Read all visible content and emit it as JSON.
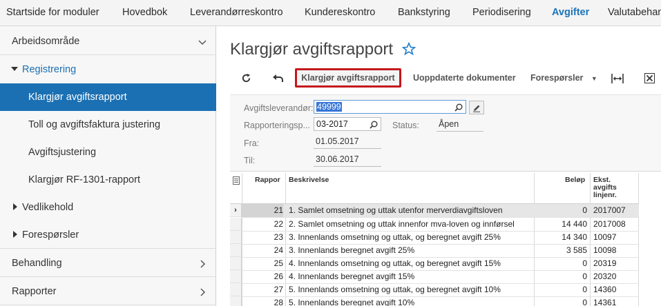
{
  "topnav": {
    "items": [
      "Startside for moduler",
      "Hovedbok",
      "Leverandørreskontro",
      "Kundereskontro",
      "Bankstyring",
      "Periodisering",
      "Avgifter",
      "Valutabehan"
    ],
    "active": "Avgifter"
  },
  "sidebar": {
    "items": [
      {
        "label": "Arbeidsområde",
        "icon": "chevron-down-icon"
      },
      {
        "label": "Registrering",
        "icon": "caret-down-icon"
      },
      {
        "label": "Klargjør avgiftsrapport"
      },
      {
        "label": "Toll og avgiftsfaktura justering"
      },
      {
        "label": "Avgiftsjustering"
      },
      {
        "label": "Klargjør RF-1301-rapport"
      },
      {
        "label": "Vedlikehold",
        "icon": "caret-right-icon"
      },
      {
        "label": "Forespørsler",
        "icon": "caret-right-icon"
      },
      {
        "label": "Behandling",
        "icon": "chevron-right-icon"
      },
      {
        "label": "Rapporter",
        "icon": "chevron-right-icon"
      }
    ]
  },
  "page": {
    "title": "Klargjør avgiftsrapport",
    "favorite_icon": "star-outline-icon"
  },
  "toolbar": {
    "refresh_icon": "refresh-icon",
    "undo_icon": "undo-icon",
    "prepare_label": "Klargjør avgiftsrapport",
    "unupdated_label": "Uoppdaterte dokumenter",
    "inquiries_label": "Forespørsler",
    "fit_icon": "fit-width-icon",
    "excel_icon": "excel-export-icon"
  },
  "form": {
    "vendor_label": "Avgiftsleverandør:",
    "vendor_value": "49999",
    "period_label": "Rapporteringsp...",
    "period_value": "03-2017",
    "status_label": "Status:",
    "status_value": "Åpen",
    "from_label": "Fra:",
    "from_value": "01.05.2017",
    "to_label": "Til:",
    "to_value": "30.06.2017"
  },
  "grid": {
    "headers": {
      "report": "Rappor",
      "description": "Beskrivelse",
      "amount": "Beløp",
      "ext1": "Ekst.",
      "ext2": "avgifts",
      "ext3": "linjenr."
    },
    "rows": [
      {
        "nr": "21",
        "desc": "1. Samlet omsetning og uttak utenfor merverdiavgiftsloven",
        "amount": "0",
        "ext": "2017007"
      },
      {
        "nr": "22",
        "desc": "2. Samlet omsetning og uttak innenfor mva-loven og innførsel",
        "amount": "14 440",
        "ext": "2017008"
      },
      {
        "nr": "23",
        "desc": "3. Innenlands omsetning og uttak, og beregnet avgift 25%",
        "amount": "14 340",
        "ext": "10097"
      },
      {
        "nr": "24",
        "desc": "3. Innenlands beregnet avgift 25%",
        "amount": "3 585",
        "ext": "10098"
      },
      {
        "nr": "25",
        "desc": "4. Innenlands omsetning og uttak, og beregnet avgift 15%",
        "amount": "0",
        "ext": "20319"
      },
      {
        "nr": "26",
        "desc": "4. Innenlands beregnet avgift 15%",
        "amount": "0",
        "ext": "20320"
      },
      {
        "nr": "27",
        "desc": "5. Innenlands omsetning og uttak, og beregnet avgift 10%",
        "amount": "0",
        "ext": "14360"
      },
      {
        "nr": "28",
        "desc": "5. Innenlands beregnet avgift 10%",
        "amount": "0",
        "ext": "14361"
      }
    ]
  }
}
